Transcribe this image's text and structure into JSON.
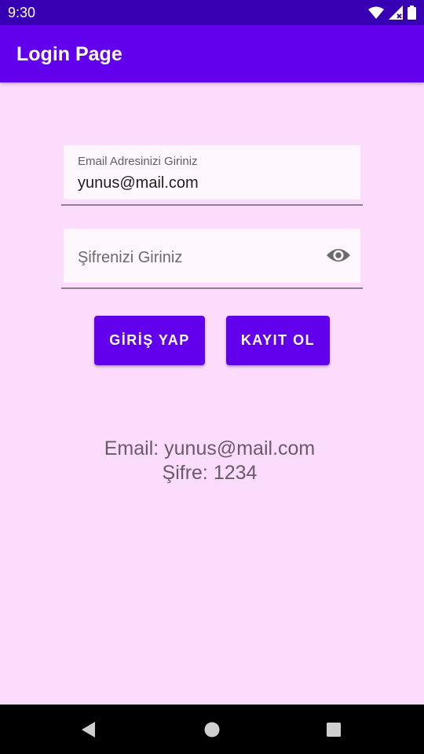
{
  "status_bar": {
    "time": "9:30",
    "icons": [
      "wifi-icon",
      "signal-icon",
      "battery-icon"
    ]
  },
  "app_bar": {
    "title": "Login Page"
  },
  "email_field": {
    "label": "Email Adresinizi Giriniz",
    "value": "yunus@mail.com"
  },
  "password_field": {
    "hint": "Şifrenizi Giriniz",
    "toggle_icon": "eye-icon"
  },
  "buttons": {
    "login_label": "GİRİŞ YAP",
    "register_label": "KAYIT OL"
  },
  "result": {
    "email_line": "Email: yunus@mail.com",
    "password_line": "Şifre: 1234"
  },
  "nav_bar": {
    "icons": [
      "back-icon",
      "home-icon",
      "recents-icon"
    ]
  },
  "colors": {
    "status_bar": "#3700B3",
    "primary": "#6200EE",
    "background": "#FCDCFC",
    "field_background": "#FDF7FD"
  }
}
